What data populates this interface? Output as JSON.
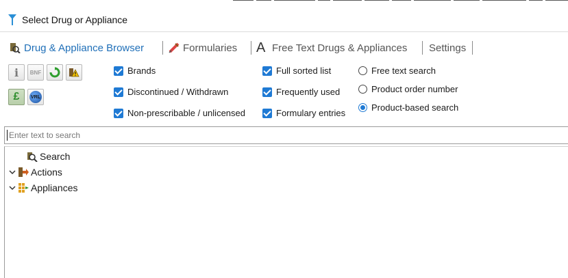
{
  "window": {
    "title": "Select Drug or Appliance"
  },
  "tabs": [
    {
      "label": "Drug & Appliance Browser",
      "icon": "drug-browser-icon",
      "active": true
    },
    {
      "label": "Formularies",
      "icon": "syringe-icon",
      "active": false
    },
    {
      "label": "Free Text Drugs & Appliances",
      "icon": "letter-a-icon",
      "active": false
    },
    {
      "label": "Settings",
      "active": false
    }
  ],
  "toolbar_buttons": [
    {
      "name": "info-icon"
    },
    {
      "name": "bnf-icon",
      "label": "BNF"
    },
    {
      "name": "refresh-icon"
    },
    {
      "name": "warning-icon"
    },
    {
      "name": "pound-icon",
      "pressed": true
    },
    {
      "name": "vrl-icon",
      "label": "VRL"
    }
  ],
  "filters": {
    "brands": "Brands",
    "discontinued": "Discontinued / Withdrawn",
    "non_prescribable": "Non-prescribable / unlicensed",
    "full_sorted": "Full sorted list",
    "frequently_used": "Frequently used",
    "formulary_entries": "Formulary entries"
  },
  "search_modes": {
    "free_text": "Free text search",
    "product_order": "Product order number",
    "product_based": "Product-based search",
    "selected": "product_based"
  },
  "search": {
    "placeholder": "Enter text to search"
  },
  "tree": {
    "search": "Search",
    "actions": "Actions",
    "appliances": "Appliances"
  },
  "colors": {
    "accent": "#1f7ad4",
    "active_tab": "#1f6fb8"
  }
}
